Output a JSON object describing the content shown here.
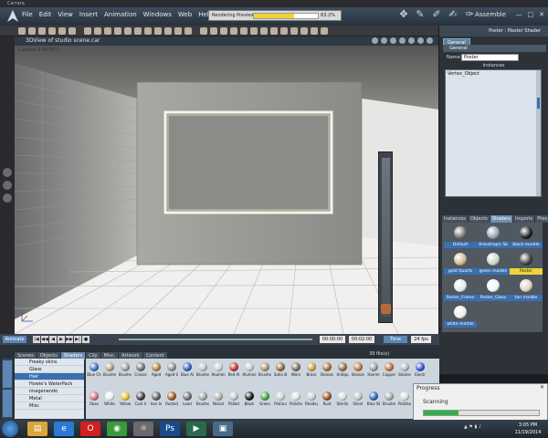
{
  "window": {
    "app_title": "Carrara"
  },
  "menu": [
    "File",
    "Edit",
    "View",
    "Insert",
    "Animation",
    "Windows",
    "Web",
    "Help"
  ],
  "render_preview": {
    "label": "Rendering Preview",
    "progress_percent": 63.2,
    "percent_text": "63.2%"
  },
  "room": {
    "label": "Assemble"
  },
  "window_controls": {
    "min": "—",
    "max": "□",
    "close": "✕"
  },
  "viewport": {
    "title": "3DView of studio scene.car",
    "camera_label": "Camera 2 99.85%"
  },
  "right_panel": {
    "header": "Poster : Master Shader",
    "tab": "General",
    "section": "General",
    "name_label": "Name:",
    "name_value": "Poster",
    "instances_label": "Instances",
    "instances": [
      "Vertex_Object"
    ]
  },
  "shader_browser": {
    "tabs": [
      "Instances",
      "Objects",
      "Shaders",
      "Imports",
      "Files"
    ],
    "active_tab": "Shaders",
    "items": [
      {
        "name": "Default",
        "color": "#6f6f6f"
      },
      {
        "name": "Anisotropic Sk",
        "color": "#8fa0b0"
      },
      {
        "name": "black marble",
        "color": "#1a1a1a"
      },
      {
        "name": "gold Quartz",
        "color": "#c9b48a"
      },
      {
        "name": "green marble",
        "color": "#c8d0c8"
      },
      {
        "name": "Poster",
        "color": "#3a3a3a"
      },
      {
        "name": "Poster_Frame",
        "color": "#e8e8e8"
      },
      {
        "name": "Poster_Glass",
        "color": "#f4f4f4"
      },
      {
        "name": "tan marble",
        "color": "#d8d0c2"
      },
      {
        "name": "white marble",
        "color": "#eeeeee"
      }
    ],
    "selected": "Poster"
  },
  "timeline": {
    "animate_label": "Animate",
    "transport": [
      "|◀",
      "◀◀",
      "◀",
      "▶",
      "▶▶",
      "▶|",
      "●"
    ],
    "time_start": "00:00:00",
    "time_end": "00:02:00",
    "time_label": "Time",
    "fps": "24 fps"
  },
  "bottom_library": {
    "tabs": [
      "Scenes",
      "Objects",
      "Shaders",
      "Clip",
      "Misc.",
      "Artwork",
      "Content"
    ],
    "active_tab": "Shaders",
    "count": "39 file(s)",
    "folders": [
      "Freaky skins",
      "Glass",
      "Hair",
      "Howie's WaterPack",
      "imagenendo",
      "Metal",
      "Misc"
    ],
    "selected_folder": "Hair",
    "shaders_row1": [
      {
        "name": "Blue Ch",
        "color": "#3b6fc8"
      },
      {
        "name": "Brushe",
        "color": "#b0a080"
      },
      {
        "name": "Brushe",
        "color": "#9c9c9c"
      },
      {
        "name": "Crosse",
        "color": "#6e6e6e"
      },
      {
        "name": "Aged",
        "color": "#b08040"
      },
      {
        "name": "Aged S",
        "color": "#8c8c8c"
      },
      {
        "name": "Blue Al",
        "color": "#2f5fbf"
      },
      {
        "name": "Brushe",
        "color": "#c0c0c0"
      },
      {
        "name": "Alumini",
        "color": "#d0d0d0"
      },
      {
        "name": "Red Al",
        "color": "#c03030"
      },
      {
        "name": "Alumini",
        "color": "#c8c8c8"
      },
      {
        "name": "Brushe",
        "color": "#a89070"
      },
      {
        "name": "Satin B",
        "color": "#8a6a3a"
      },
      {
        "name": "Worn",
        "color": "#7a6a5a"
      },
      {
        "name": "Brass",
        "color": "#c8a040"
      },
      {
        "name": "Bronze",
        "color": "#a07030"
      },
      {
        "name": "Antiqu",
        "color": "#8a7040"
      },
      {
        "name": "Bronze",
        "color": "#b07840"
      },
      {
        "name": "Hamm",
        "color": "#9a9a9a"
      },
      {
        "name": "Copper",
        "color": "#c06a30"
      },
      {
        "name": "Stainle",
        "color": "#b8b8b8"
      },
      {
        "name": "Electr",
        "color": "#3050d0"
      }
    ],
    "shaders_row2": [
      {
        "name": "Rose",
        "color": "#d07080"
      },
      {
        "name": "White",
        "color": "#f0f0f0"
      },
      {
        "name": "Yellow",
        "color": "#e0c030"
      },
      {
        "name": "Cast Ir",
        "color": "#3a3a3a"
      },
      {
        "name": "Iron In",
        "color": "#5a5a5a"
      },
      {
        "name": "Rusted",
        "color": "#a05020"
      },
      {
        "name": "Lead",
        "color": "#6a6a70"
      },
      {
        "name": "Brushe",
        "color": "#a0a0a0"
      },
      {
        "name": "Nickel",
        "color": "#b0b0a8"
      },
      {
        "name": "Pallad",
        "color": "#c0c0c8"
      },
      {
        "name": "Black",
        "color": "#151515"
      },
      {
        "name": "Green",
        "color": "#40a040"
      },
      {
        "name": "Platinu",
        "color": "#d0d0d0"
      },
      {
        "name": "Polishe",
        "color": "#e0e0e0"
      },
      {
        "name": "Rhodiu",
        "color": "#c8c8d0"
      },
      {
        "name": "Rust",
        "color": "#9a4a20"
      },
      {
        "name": "Sterlin",
        "color": "#d8d8d8"
      },
      {
        "name": "Silver",
        "color": "#c0c0c0"
      },
      {
        "name": "Blue St",
        "color": "#3060b0"
      },
      {
        "name": "Brushe",
        "color": "#a8a8a8"
      },
      {
        "name": "Polishe",
        "color": "#dcdcdc"
      }
    ]
  },
  "progress_dialog": {
    "title": "Progress",
    "close": "✕",
    "message": "Scanning",
    "progress_percent": 30
  },
  "taskbar": {
    "apps": [
      {
        "name": "file-explorer",
        "glyph": "▤",
        "color": "#d9a63a"
      },
      {
        "name": "internet-explorer",
        "glyph": "e",
        "color": "#2a7ad4"
      },
      {
        "name": "opera",
        "glyph": "O",
        "color": "#d02020"
      },
      {
        "name": "chrome",
        "glyph": "◉",
        "color": "#3a9a3a"
      },
      {
        "name": "carrara",
        "glyph": "☼",
        "color": "#6a6a6a"
      },
      {
        "name": "photoshop",
        "glyph": "Ps",
        "color": "#1a4a8a"
      },
      {
        "name": "video-player",
        "glyph": "▶",
        "color": "#2a6a4a"
      },
      {
        "name": "app-window",
        "glyph": "▣",
        "color": "#4a6a8a"
      }
    ],
    "time": "3:05 PM",
    "date": "11/19/2014"
  }
}
